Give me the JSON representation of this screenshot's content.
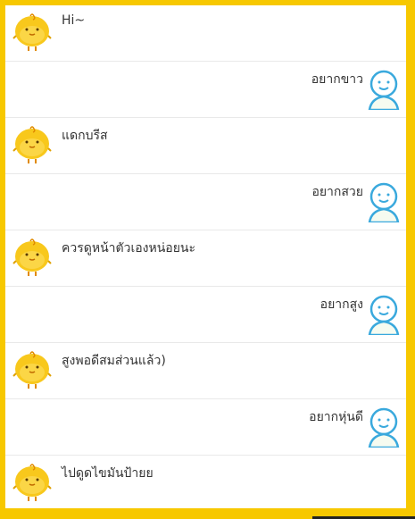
{
  "chat": {
    "messages": [
      {
        "sender": "bot",
        "text": "Hi~",
        "avatar_icon": "yellow-chick-avatar-icon"
      },
      {
        "sender": "user",
        "text": "อยากขาว",
        "avatar_icon": "user-outline-avatar-icon"
      },
      {
        "sender": "bot",
        "text": "แดกบรีส",
        "avatar_icon": "yellow-chick-avatar-icon"
      },
      {
        "sender": "user",
        "text": "อยากสวย",
        "avatar_icon": "user-outline-avatar-icon"
      },
      {
        "sender": "bot",
        "text": "ควรดูหน้าตัวเองหน่อยนะ",
        "avatar_icon": "yellow-chick-avatar-icon"
      },
      {
        "sender": "user",
        "text": "อยากสูง",
        "avatar_icon": "user-outline-avatar-icon"
      },
      {
        "sender": "bot",
        "text": "สูงพอดีสมส่วนแล้ว)",
        "avatar_icon": "yellow-chick-avatar-icon"
      },
      {
        "sender": "user",
        "text": "อยากหุ่นดี",
        "avatar_icon": "user-outline-avatar-icon"
      },
      {
        "sender": "bot",
        "text": "ไปดูดไขมันป้ายย",
        "avatar_icon": "yellow-chick-avatar-icon"
      }
    ]
  },
  "colors": {
    "frame": "#f7c800",
    "chick_body": "#f8c81c",
    "user_outline": "#3aa9dd",
    "text": "#333333"
  }
}
